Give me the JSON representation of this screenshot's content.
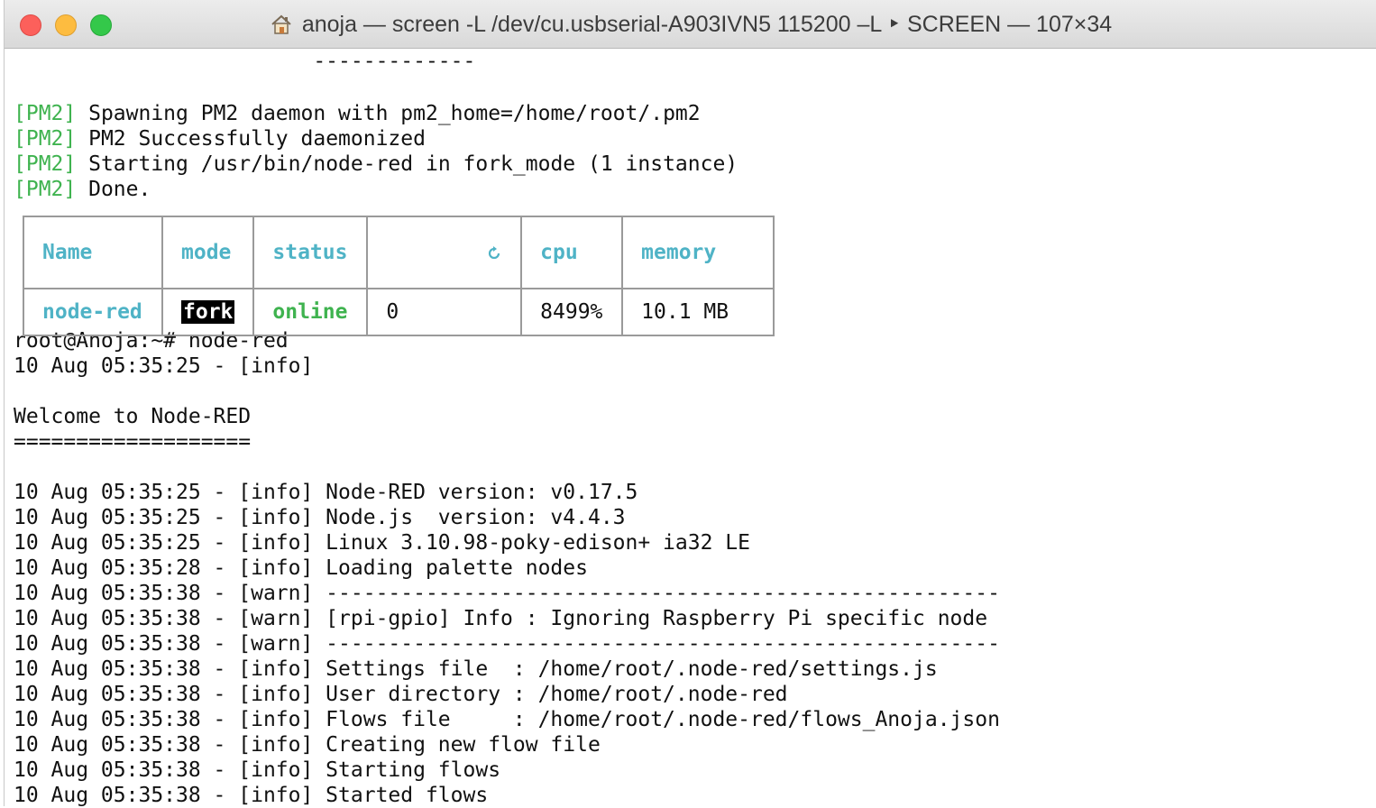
{
  "window": {
    "title": "anoja — screen -L /dev/cu.usbserial-A903IVN5 115200 –L ‣ SCREEN — 107×34",
    "icon": "home-icon"
  },
  "terminal": {
    "top_lines": [
      {
        "text": "                        -------------"
      },
      {
        "text": ""
      }
    ],
    "pm2_lines": [
      {
        "tag": "[PM2]",
        "text": " Spawning PM2 daemon with pm2_home=/home/root/.pm2"
      },
      {
        "tag": "[PM2]",
        "text": " PM2 Successfully daemonized"
      },
      {
        "tag": "[PM2]",
        "text": " Starting /usr/bin/node-red in fork_mode (1 instance)"
      },
      {
        "tag": "[PM2]",
        "text": " Done."
      }
    ],
    "table": {
      "headers": [
        "Name",
        "mode",
        "status",
        "restart-icon",
        "cpu",
        "memory"
      ],
      "row": {
        "name": "node-red",
        "mode": "fork",
        "status": "online",
        "restarts": "0",
        "cpu": "8499%",
        "memory": "10.1 MB"
      }
    },
    "log_lines": [
      "root@Anoja:~# node-red",
      "10 Aug 05:35:25 - [info]",
      "",
      "Welcome to Node-RED",
      "===================",
      "",
      "10 Aug 05:35:25 - [info] Node-RED version: v0.17.5",
      "10 Aug 05:35:25 - [info] Node.js  version: v4.4.3",
      "10 Aug 05:35:25 - [info] Linux 3.10.98-poky-edison+ ia32 LE",
      "10 Aug 05:35:28 - [info] Loading palette nodes",
      "10 Aug 05:35:38 - [warn] ------------------------------------------------------",
      "10 Aug 05:35:38 - [warn] [rpi-gpio] Info : Ignoring Raspberry Pi specific node",
      "10 Aug 05:35:38 - [warn] ------------------------------------------------------",
      "10 Aug 05:35:38 - [info] Settings file  : /home/root/.node-red/settings.js",
      "10 Aug 05:35:38 - [info] User directory : /home/root/.node-red",
      "10 Aug 05:35:38 - [info] Flows file     : /home/root/.node-red/flows_Anoja.json",
      "10 Aug 05:35:38 - [info] Creating new flow file",
      "10 Aug 05:35:38 - [info] Starting flows",
      "10 Aug 05:35:38 - [info] Started flows"
    ]
  },
  "colors": {
    "pm2_tag": "#3fb34f",
    "table_header": "#4fb3c6",
    "online": "#3fb34f"
  }
}
